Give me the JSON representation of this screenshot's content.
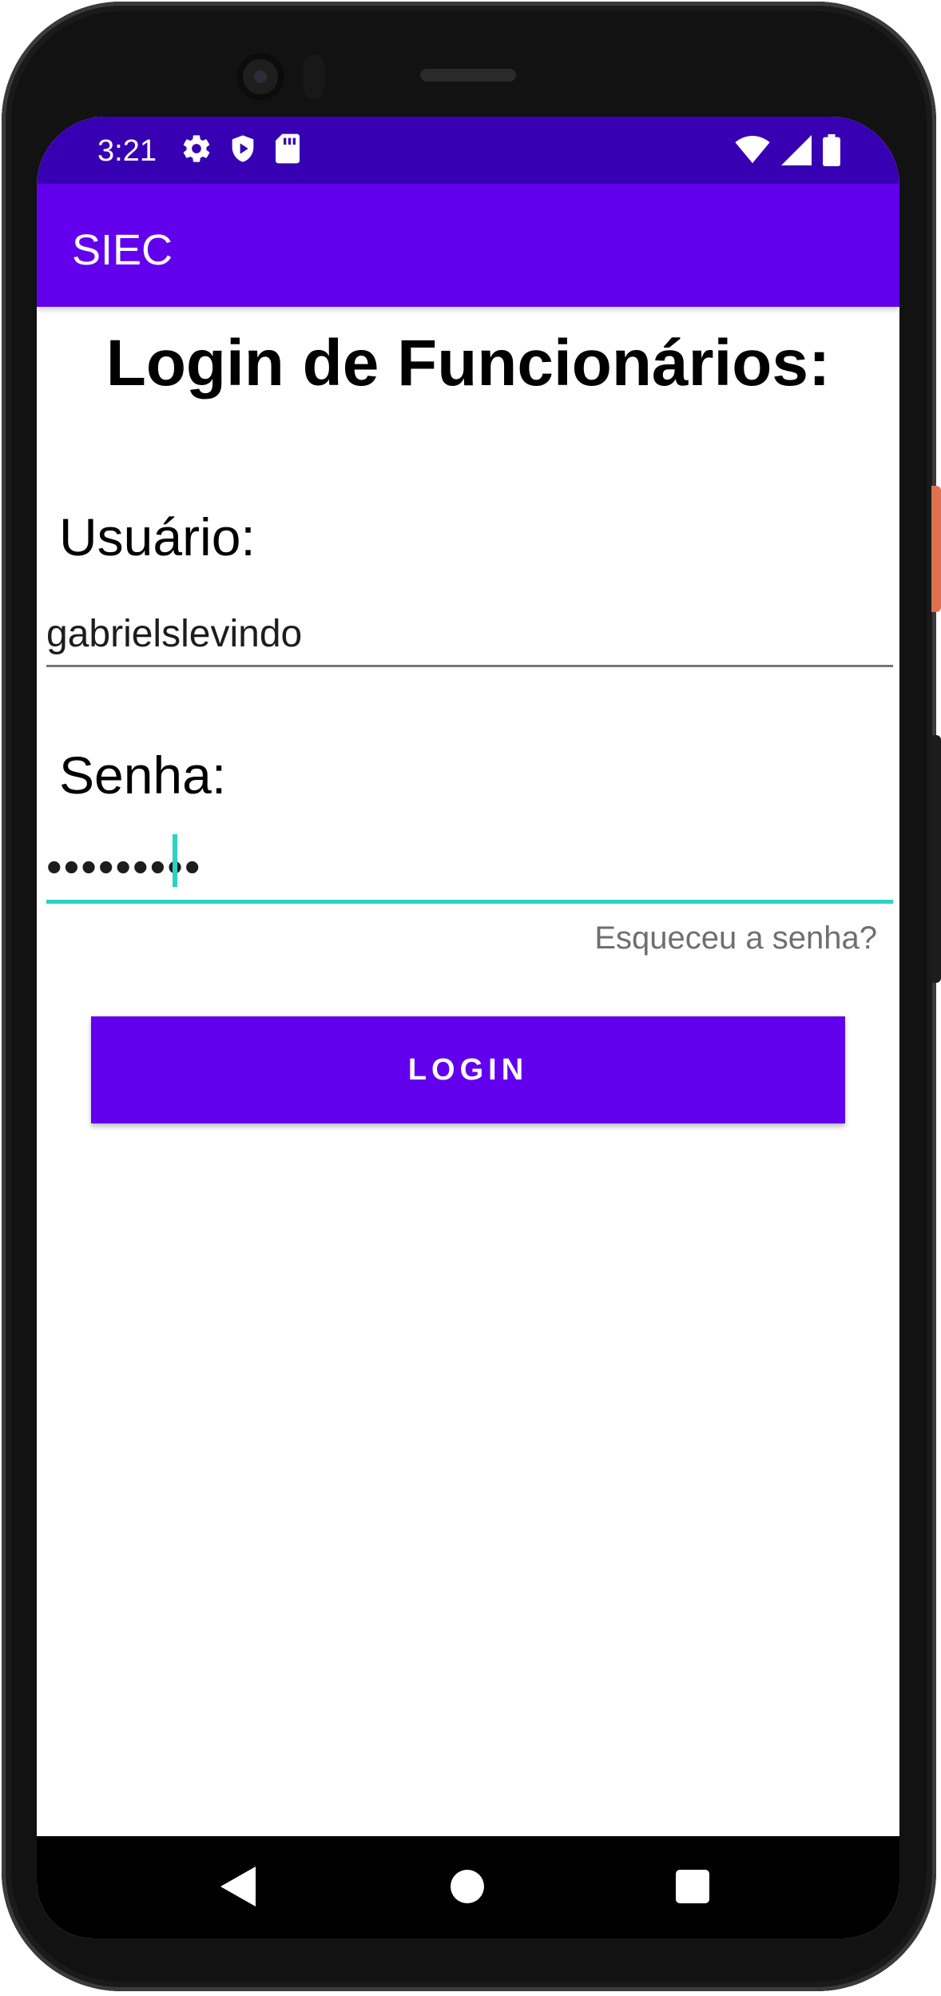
{
  "status_bar": {
    "time": "3:21",
    "left_icons": [
      "gear-icon",
      "shield-play-icon",
      "sd-card-icon"
    ],
    "right_icons": [
      "wifi-icon",
      "cell-signal-icon",
      "battery-icon"
    ],
    "background_color": "#3700b3"
  },
  "app_bar": {
    "title": "SIEC",
    "background_color": "#6200ee"
  },
  "page": {
    "title": "Login de Funcionários:"
  },
  "form": {
    "username_label": "Usuário:",
    "username_value": "gabrielslevindo",
    "password_label": "Senha:",
    "password_masked": "•••••••••",
    "forgot_password": "Esqueceu a senha?",
    "login_button": "LOGIN",
    "focus_color": "#2bd4c0"
  },
  "navigation_bar": {
    "buttons": [
      "back-icon",
      "home-icon",
      "recents-icon"
    ]
  }
}
